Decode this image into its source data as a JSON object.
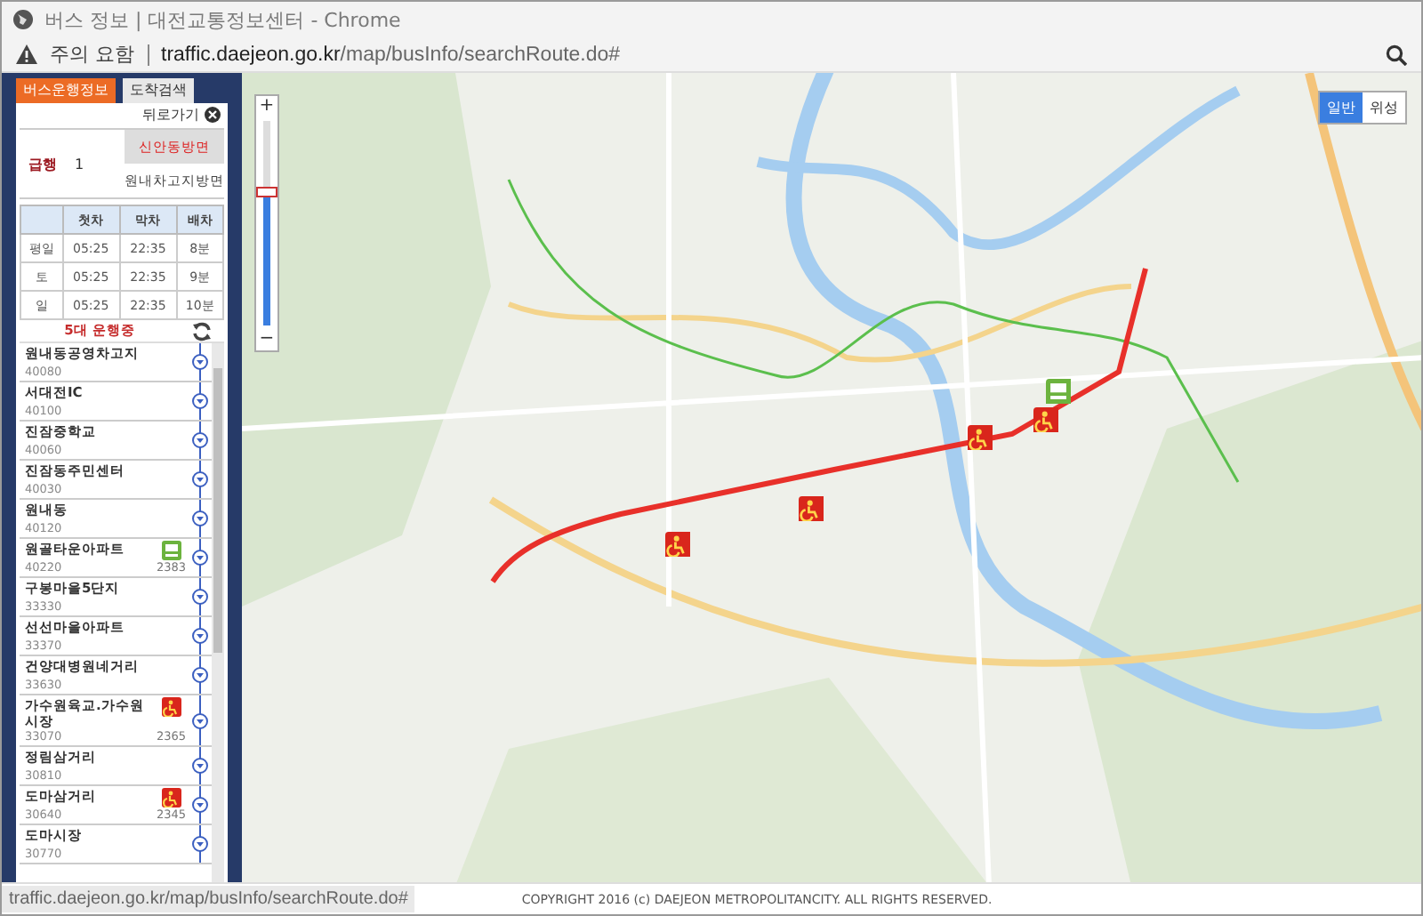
{
  "window": {
    "title": "버스 정보 | 대전교통정보센터 - Chrome"
  },
  "address_bar": {
    "security": "주의 요함",
    "url_host": "traffic.daejeon.go.kr",
    "url_path": "/map/busInfo/searchRoute.do#"
  },
  "sidebar": {
    "tabs": [
      {
        "label": "버스운행정보",
        "selected": true
      },
      {
        "label": "도착검색",
        "selected": false
      }
    ],
    "back": "뒤로가기",
    "route": {
      "type": "급행",
      "number": "1"
    },
    "directions": [
      {
        "label": "신안동방면",
        "selected": true
      },
      {
        "label": "원내차고지방면",
        "selected": false
      }
    ],
    "timetable": {
      "columns": [
        "첫차",
        "막차",
        "배차"
      ],
      "rows": [
        {
          "day": "평일",
          "first": "05:25",
          "last": "22:35",
          "interval": "8분"
        },
        {
          "day": "토",
          "first": "05:25",
          "last": "22:35",
          "interval": "9분"
        },
        {
          "day": "일",
          "first": "05:25",
          "last": "22:35",
          "interval": "10분"
        }
      ]
    },
    "running": "5대 운행중",
    "stops": [
      {
        "name": "원내동공영차고지",
        "id": "40080"
      },
      {
        "name": "서대전IC",
        "id": "40100"
      },
      {
        "name": "진잠중학교",
        "id": "40060"
      },
      {
        "name": "진잠동주민센터",
        "id": "40030"
      },
      {
        "name": "원내동",
        "id": "40120"
      },
      {
        "name": "원골타운아파트",
        "id": "40220",
        "bus": {
          "kind": "regular",
          "number": "2383"
        }
      },
      {
        "name": "구봉마을5단지",
        "id": "33330"
      },
      {
        "name": "선선마을아파트",
        "id": "33370"
      },
      {
        "name": "건양대병원네거리",
        "id": "33630"
      },
      {
        "name": "가수원육교.가수원시장",
        "id": "33070",
        "bus": {
          "kind": "low-floor",
          "number": "2365"
        }
      },
      {
        "name": "정림삼거리",
        "id": "30810"
      },
      {
        "name": "도마삼거리",
        "id": "30640",
        "bus": {
          "kind": "low-floor",
          "number": "2345"
        }
      },
      {
        "name": "도마시장",
        "id": "30770"
      }
    ]
  },
  "map": {
    "zoom": {
      "in": "+",
      "out": "−",
      "level": 0.66
    },
    "map_types": [
      {
        "label": "일반",
        "selected": true
      },
      {
        "label": "위성",
        "selected": false
      }
    ],
    "buses": [
      {
        "kind": "low-floor"
      },
      {
        "kind": "low-floor"
      },
      {
        "kind": "low-floor"
      },
      {
        "kind": "low-floor"
      },
      {
        "kind": "regular"
      }
    ]
  },
  "footer": {
    "copyright": "COPYRIGHT 2016 (c) DAEJEON METROPOLITANCITY. ALL RIGHTS RESERVED."
  },
  "status_bar": {
    "url": "traffic.daejeon.go.kr/map/busInfo/searchRoute.do#"
  }
}
